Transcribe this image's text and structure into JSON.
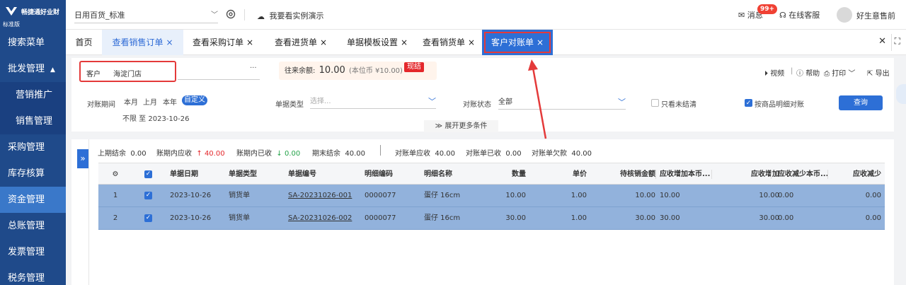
{
  "sidebar": {
    "brand": "畅捷通好业财",
    "edition": "标准版",
    "items": [
      {
        "label": "搜索菜单",
        "type": "top"
      },
      {
        "label": "批发管理",
        "type": "top",
        "caret": "▲"
      },
      {
        "label": "营销推广",
        "type": "sub"
      },
      {
        "label": "销售管理",
        "type": "sub"
      },
      {
        "label": "采购管理",
        "type": "top"
      },
      {
        "label": "库存核算",
        "type": "top"
      },
      {
        "label": "资金管理",
        "type": "active"
      },
      {
        "label": "总账管理",
        "type": "top"
      },
      {
        "label": "发票管理",
        "type": "top"
      },
      {
        "label": "税务管理",
        "type": "top"
      }
    ]
  },
  "topbar": {
    "account": "日用百货_标准",
    "demo": "我要看实例演示",
    "messages": "消息",
    "message_badge": "99+",
    "service": "在线客服",
    "username": "好生意售前"
  },
  "tabs": [
    {
      "label": "首页",
      "closable": false
    },
    {
      "label": "查看销售订单",
      "closable": true
    },
    {
      "label": "查看采购订单",
      "closable": true
    },
    {
      "label": "查看进货单",
      "closable": true
    },
    {
      "label": "单据模板设置",
      "closable": true
    },
    {
      "label": "查看销货单",
      "closable": true
    },
    {
      "label": "客户对账单",
      "closable": true
    }
  ],
  "tab_close_symbol": "×",
  "header": {
    "customer_label": "客户",
    "customer_value": "海淀门店",
    "more": "···",
    "balance_label": "往来余额:",
    "balance_value": "10.00",
    "balance_sub": "(本位币 ¥10.00)",
    "pay_button": "现结",
    "video": "视频",
    "help": "帮助",
    "print": "打印",
    "export": "导出"
  },
  "filters": {
    "period_label": "对账期间",
    "period_options": [
      "本月",
      "上月",
      "本年",
      "自定义"
    ],
    "period_active": "自定义",
    "period_value": "不限 至 2023-10-26",
    "doc_type_label": "单据类型",
    "doc_type_placeholder": "选择...",
    "status_label": "对账状态",
    "status_value": "全部",
    "only_unsettled": "只看未结清",
    "by_item": "按商品明细对账",
    "query_button": "查询",
    "expand": "展开更多条件"
  },
  "summary": {
    "prev_balance_label": "上期结余",
    "prev_balance": "0.00",
    "period_receivable_label": "账期内应收",
    "period_receivable": "40.00",
    "period_received_label": "账期内已收",
    "period_received": "0.00",
    "end_balance_label": "期末结余",
    "end_balance": "40.00",
    "stmt_receivable_label": "对账单应收",
    "stmt_receivable": "40.00",
    "stmt_received_label": "对账单已收",
    "stmt_received": "0.00",
    "stmt_owed_label": "对账单欠款",
    "stmt_owed": "40.00"
  },
  "table": {
    "headers": [
      "单据日期",
      "单据类型",
      "单据编号",
      "明细编码",
      "明细名称",
      "数量",
      "单价",
      "待核销金额",
      "应收增加本币...",
      "应收增加",
      "应收减少本币...",
      "应收减少"
    ],
    "rows": [
      {
        "no": "1",
        "date": "2023-10-26",
        "type": "销货单",
        "code": "SA-20231026-001",
        "item_code": "0000077",
        "item_name": "蛋仔 16cm",
        "qty": "10.00",
        "price": "1.00",
        "pending": "10.00",
        "inc_base": "10.00",
        "inc": "10.00",
        "dec_base": "0.00",
        "dec": "0.00"
      },
      {
        "no": "2",
        "date": "2023-10-26",
        "type": "销货单",
        "code": "SA-20231026-002",
        "item_code": "0000077",
        "item_name": "蛋仔 16cm",
        "qty": "30.00",
        "price": "1.00",
        "pending": "30.00",
        "inc_base": "30.00",
        "inc": "30.00",
        "dec_base": "0.00",
        "dec": "0.00"
      }
    ]
  },
  "colors": {
    "sidebar_bg": "#1f4a8a",
    "accent": "#2d6fd6",
    "highlight_red": "#e43a3a",
    "selected_row": "#92b2dc"
  }
}
